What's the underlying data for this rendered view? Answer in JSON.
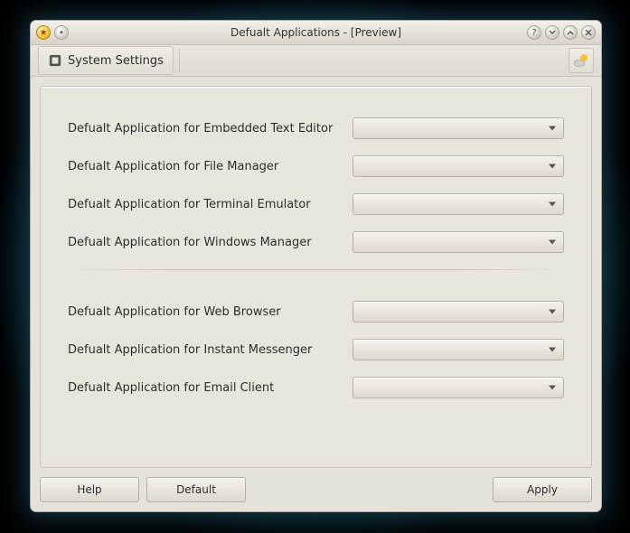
{
  "window": {
    "title": "Defualt Applications - [Preview]"
  },
  "toolbar": {
    "system_settings_label": "System Settings"
  },
  "form": {
    "group1": [
      {
        "label": "Defualt Application for Embedded Text Editor",
        "value": ""
      },
      {
        "label": "Defualt Application for File Manager",
        "value": ""
      },
      {
        "label": "Defualt Application for Terminal Emulator",
        "value": ""
      },
      {
        "label": "Defualt Application for Windows Manager",
        "value": ""
      }
    ],
    "group2": [
      {
        "label": "Defualt Application for Web Browser",
        "value": ""
      },
      {
        "label": "Defualt Application for Instant Messenger",
        "value": ""
      },
      {
        "label": "Defualt Application for Email Client",
        "value": ""
      }
    ]
  },
  "buttons": {
    "help": "Help",
    "default": "Default",
    "apply": "Apply"
  }
}
